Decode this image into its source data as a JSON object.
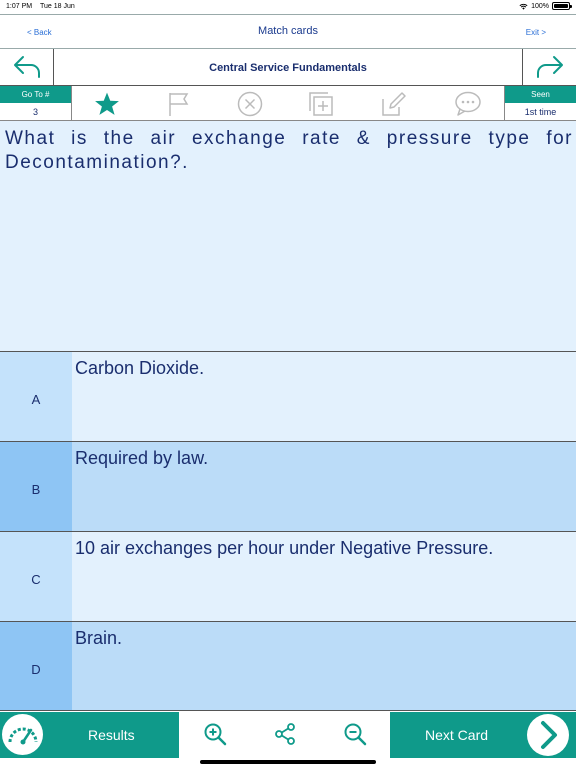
{
  "status": {
    "time": "1:07 PM",
    "date": "Tue 18 Jun",
    "battery": "100%"
  },
  "nav": {
    "back_label": "< Back",
    "title": "Match cards",
    "exit_label": "Exit >"
  },
  "card": {
    "title": "Central Service Fundamentals"
  },
  "toolbar": {
    "goto_label": "Go To #",
    "goto_value": "3",
    "seen_label": "Seen",
    "seen_value": "1st time",
    "icons": [
      "star-icon",
      "flag-icon",
      "close-circle-icon",
      "add-card-icon",
      "edit-icon",
      "comment-icon"
    ],
    "accent": "#0f9a8a"
  },
  "question": {
    "text": "What is the air exchange rate & pressure type for Decontamination?."
  },
  "answers": [
    {
      "letter": "A",
      "text": "Carbon Dioxide."
    },
    {
      "letter": "B",
      "text": "Required by law."
    },
    {
      "letter": "C",
      "text": "10 air exchanges per hour under Negative Pressure."
    },
    {
      "letter": "D",
      "text": "Brain."
    }
  ],
  "bottom": {
    "results_label": "Results",
    "next_label": "Next Card"
  },
  "colors": {
    "accent": "#0f9a8a",
    "question_bg": "#e3f1fd",
    "answer_alt_bg": "#bbdcf8",
    "text": "#1a2e6e"
  }
}
